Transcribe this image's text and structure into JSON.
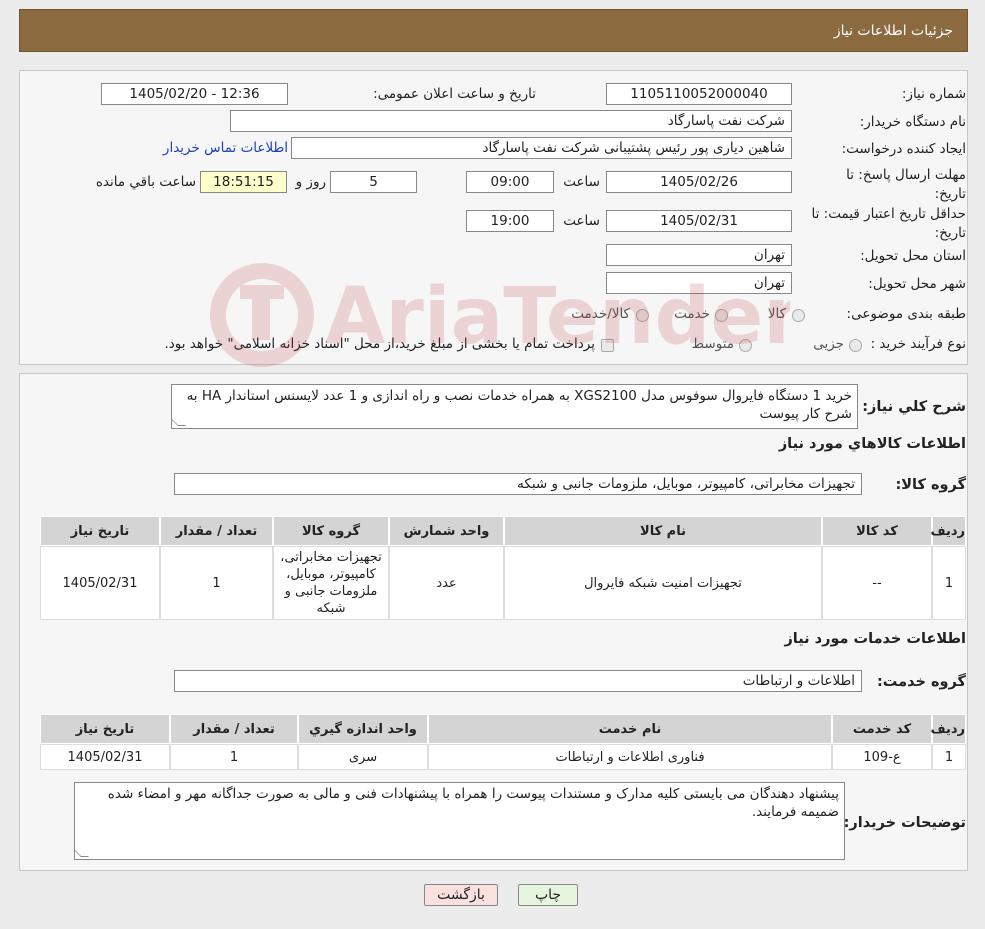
{
  "header": {
    "title": "جزئیات اطلاعات نیاز"
  },
  "form": {
    "need_number_label": "شماره نیاز:",
    "need_number": "1105110052000040",
    "announce_label": "تاریخ و ساعت اعلان عمومی:",
    "announce_value": "1405/02/20 - 12:36",
    "buyer_org_label": "نام دستگاه خریدار:",
    "buyer_org": "شرکت نفت پاسارگاد",
    "creator_label": "ایجاد کننده درخواست:",
    "creator": "شاهین دیاری پور رئیس پشتیبانی شرکت نفت پاسارگاد",
    "contact_link": "اطلاعات تماس خریدار",
    "deadline_label": "مهلت ارسال پاسخ: تا تاریخ:",
    "deadline_date": "1405/02/26",
    "time_label": "ساعت",
    "deadline_time": "09:00",
    "days_value": "5",
    "days_label": "روز و",
    "remaining_time": "18:51:15",
    "remaining_label": "ساعت باقي مانده",
    "validity_label": "حداقل تاریخ اعتبار قیمت: تا تاریخ:",
    "validity_date": "1405/02/31",
    "validity_time": "19:00",
    "province_label": "استان محل تحویل:",
    "province": "تهران",
    "city_label": "شهر محل تحویل:",
    "city": "تهران",
    "category_label": "طبقه بندی موضوعی:",
    "category_options": [
      "کالا",
      "خدمت",
      "کالا/خدمت"
    ],
    "process_label": "نوع فرآیند خرید :",
    "process_options": [
      "جزیی",
      "متوسط"
    ],
    "process_note": "پرداخت تمام یا بخشی از مبلغ خرید،از محل \"اسناد خزانه اسلامی\" خواهد بود."
  },
  "details": {
    "summary_label": "شرح کلي نياز:",
    "summary": "خرید 1 دستگاه فایروال سوفوس مدل XGS2100 به همراه خدمات نصب و راه اندازی و 1 عدد لایسنس استاندار HA به شرح کار پیوست",
    "goods_title": "اطلاعات کالاهاي مورد نياز",
    "goods_group_label": "گروه کالا:",
    "goods_group": "تجهیزات مخابراتی، کامپیوتر، موبایل، ملزومات جانبی و شبکه",
    "goods_table": {
      "headers": [
        "رديف",
        "کد کالا",
        "نام کالا",
        "واحد شمارش",
        "گروه کالا",
        "تعداد / مقدار",
        "تاريخ نياز"
      ],
      "rows": [
        [
          "1",
          "--",
          "تجهیزات امنیت شبکه فایروال",
          "عدد",
          "تجهیزات مخابراتی، کامپیوتر، موبایل، ملزومات جانبی و شبکه",
          "1",
          "1405/02/31"
        ]
      ]
    },
    "services_title": "اطلاعات خدمات مورد نياز",
    "service_group_label": "گروه خدمت:",
    "service_group": "اطلاعات و ارتباطات",
    "services_table": {
      "headers": [
        "رديف",
        "کد خدمت",
        "نام خدمت",
        "واحد اندازه گيري",
        "تعداد / مقدار",
        "تاريخ نياز"
      ],
      "rows": [
        [
          "1",
          "ع-109",
          "فناوری اطلاعات و ارتباطات",
          "سری",
          "1",
          "1405/02/31"
        ]
      ]
    },
    "notes_label": "توضیحات خریدار:",
    "notes": "پیشنهاد دهندگان می بایستی کلیه مدارک و مستندات پیوست را همراه با پیشنهادات فنی و مالی به صورت جداگانه مهر و امضاء شده ضمیمه فرمایند."
  },
  "buttons": {
    "print": "چاپ",
    "back": "بازگشت"
  },
  "colors": {
    "header_bg": "#8a6a3e",
    "back_button_bg": "#fbe0e0",
    "print_button_bg": "#e6f5dd",
    "link": "#1c3fb5"
  }
}
